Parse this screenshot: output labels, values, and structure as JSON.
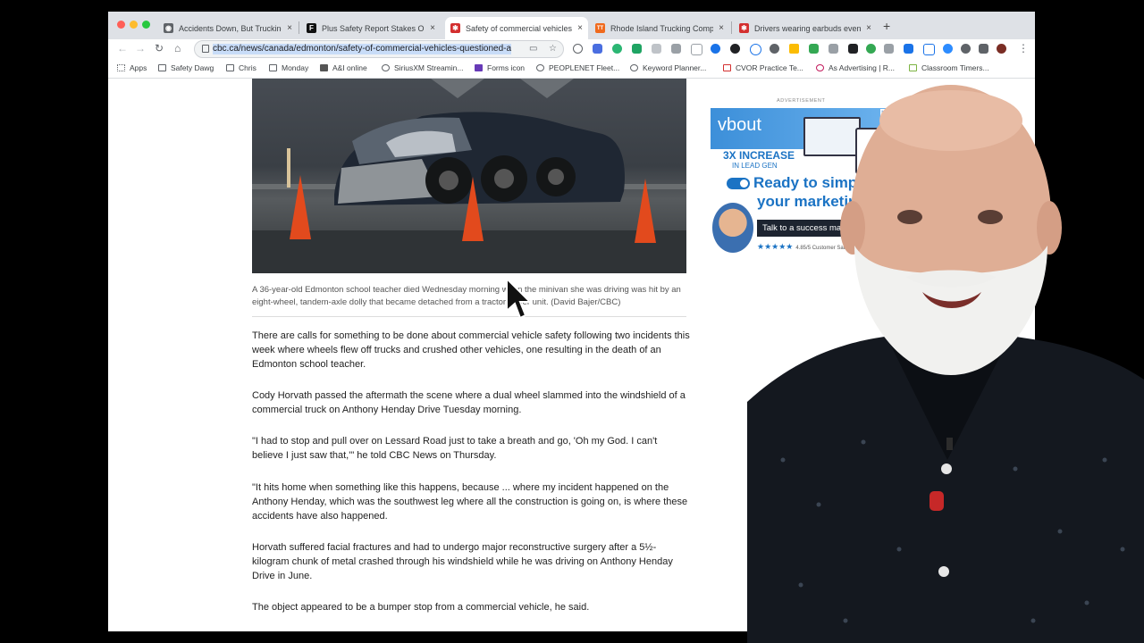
{
  "browser": {
    "tabs": [
      {
        "title": "Accidents Down, But Trucking",
        "favicon_color": "#5f6368",
        "favicon_glyph": "◉"
      },
      {
        "title": "Plus Safety Report Stakes Out",
        "favicon_color": "#111111",
        "favicon_glyph": "F"
      },
      {
        "title": "Safety of commercial vehicles",
        "favicon_color": "#d32f2f",
        "favicon_glyph": "✱",
        "active": true
      },
      {
        "title": "Rhode Island Trucking Compan",
        "favicon_color": "#f06a1d",
        "favicon_glyph": "TT"
      },
      {
        "title": "Drivers wearing earbuds even",
        "favicon_color": "#d32f2f",
        "favicon_glyph": "✱"
      }
    ],
    "new_tab_glyph": "+",
    "close_glyph": "×",
    "url": "cbc.ca/news/canada/edmonton/safety-of-commercial-vehicles-questioned-a",
    "bookmarks": [
      "Apps",
      "Safety Dawg",
      "Chris",
      "Monday",
      "A&I online",
      "SiriusXM Streamin...",
      "Forms icon",
      "PEOPLENET Fleet...",
      "Keyword Planner...",
      "CVOR Practice Te...",
      "As Advertising | R...",
      "Classroom Timers..."
    ]
  },
  "article": {
    "caption": "A 36-year-old Edmonton school teacher died Wednesday morning when the minivan she was driving was hit by an eight-wheel, tandem-axle dolly that became detached from a tractor-trailer unit. (David Bajer/CBC)",
    "paragraphs": [
      "There are calls for something to be done about commercial vehicle safety following two incidents this week where wheels flew off trucks and crushed other vehicles, one resulting in the death of an Edmonton school teacher.",
      "Cody Horvath passed the aftermath the scene where a dual wheel slammed into the windshield of a commercial truck on Anthony Henday Drive Tuesday morning.",
      "\"I had to stop and pull over on Lessard Road just to take a breath and go, 'Oh my God. I can't believe I just saw that,'\" he told CBC News on Thursday.",
      "\"It hits home when something like this happens, because ... where my incident happened on the Anthony Henday, which was the southwest leg where all the construction is going on, is where these accidents have also happened.",
      "Horvath suffered facial fractures and had to undergo major reconstructive surgery after a 5½-kilogram chunk of metal crashed through his windshield while he was driving on Anthony Henday Drive in June.",
      "The object appeared to be a bumper stop from a commercial vehicle, he said."
    ]
  },
  "ad": {
    "label": "ADVERTISEMENT",
    "brand": "vbout",
    "headline_stat": "3X INCREASE",
    "headline_sub": "IN LEAD GEN",
    "line1": "Ready to simplify",
    "line2": "your marketing?",
    "cta": "Talk to a success manager",
    "rating": "★★★★★",
    "rating_text": "4.85/5 Customer Satisfaction",
    "adchoices": "▷✕"
  },
  "colors": {
    "accent": "#1b73c4",
    "cone": "#e24a1d",
    "selection": "#c8dcf8"
  }
}
